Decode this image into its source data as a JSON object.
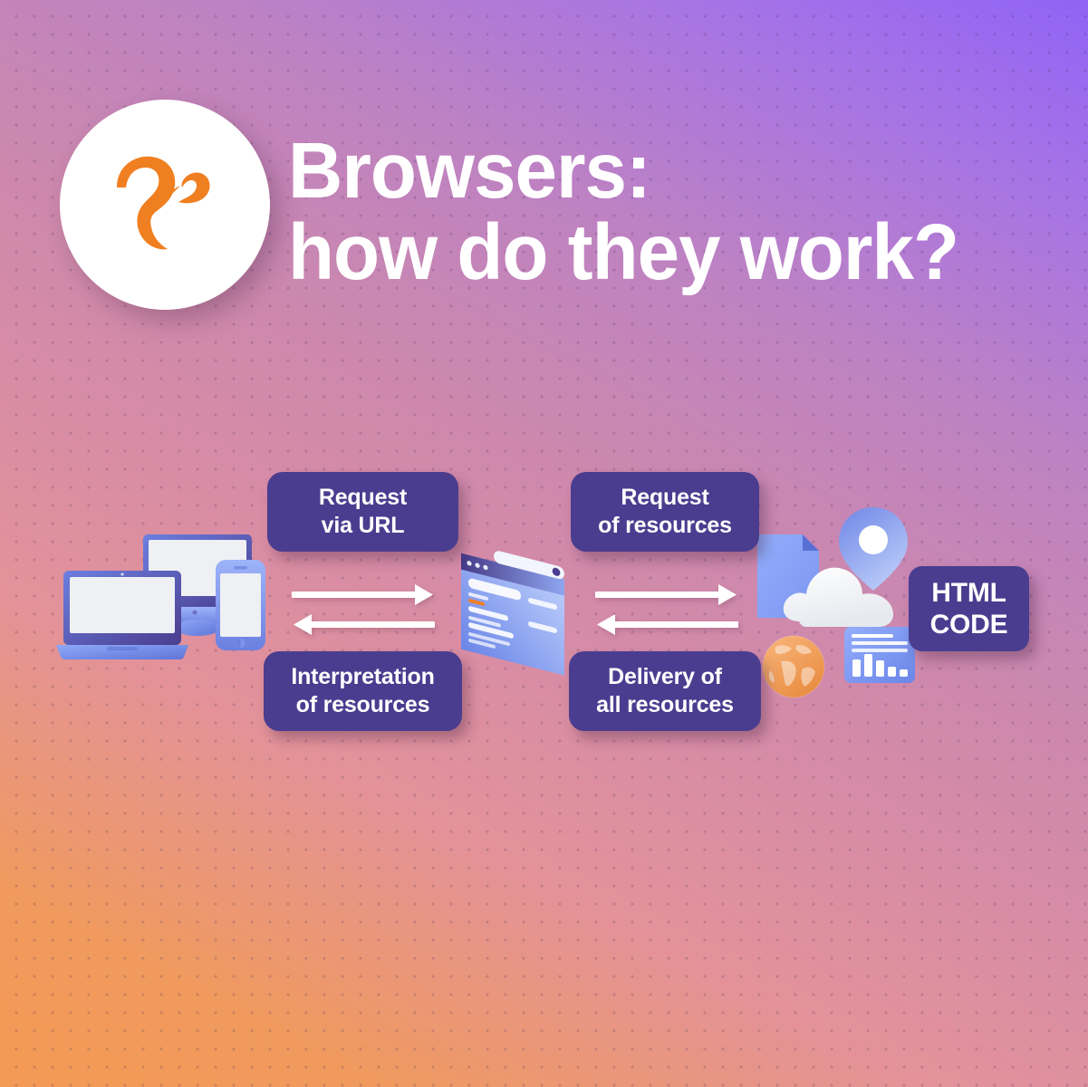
{
  "poster": {
    "background": {
      "gradient_from": "#f59a55",
      "gradient_mid": "#cc88ad",
      "gradient_to": "#9163f5",
      "pattern": "dot-grid"
    },
    "accent_purple": "#4a3d8f",
    "accent_orange": "#f07f21",
    "device_blue": "#7d9bf2"
  },
  "header": {
    "logo_icon": "squirrel-logo-icon",
    "title_line1": "Browsers:",
    "title_line2": "how do they work?"
  },
  "diagram": {
    "devices_icon": "devices-laptop-monitor-phone-icon",
    "browser_icon": "browser-window-icon",
    "cloud_icon": "cloud-server-icon",
    "document_icon": "document-file-icon",
    "map_pin_icon": "map-pin-icon",
    "globe_icon": "globe-icon",
    "chart_card_icon": "chart-dashboard-icon",
    "steps": [
      {
        "id": "request-url",
        "line1": "Request",
        "line2": "via URL"
      },
      {
        "id": "interpretation",
        "line1": "Interpretation",
        "line2": "of resources"
      },
      {
        "id": "request-res",
        "line1": "Request",
        "line2": "of resources"
      },
      {
        "id": "delivery",
        "line1": "Delivery of",
        "line2": "all resources"
      }
    ],
    "html_badge": {
      "line1": "HTML",
      "line2": "CODE"
    },
    "arrows": {
      "left_pair": {
        "top_direction": "right",
        "bottom_direction": "left"
      },
      "right_pair": {
        "top_direction": "right",
        "bottom_direction": "left"
      }
    }
  }
}
